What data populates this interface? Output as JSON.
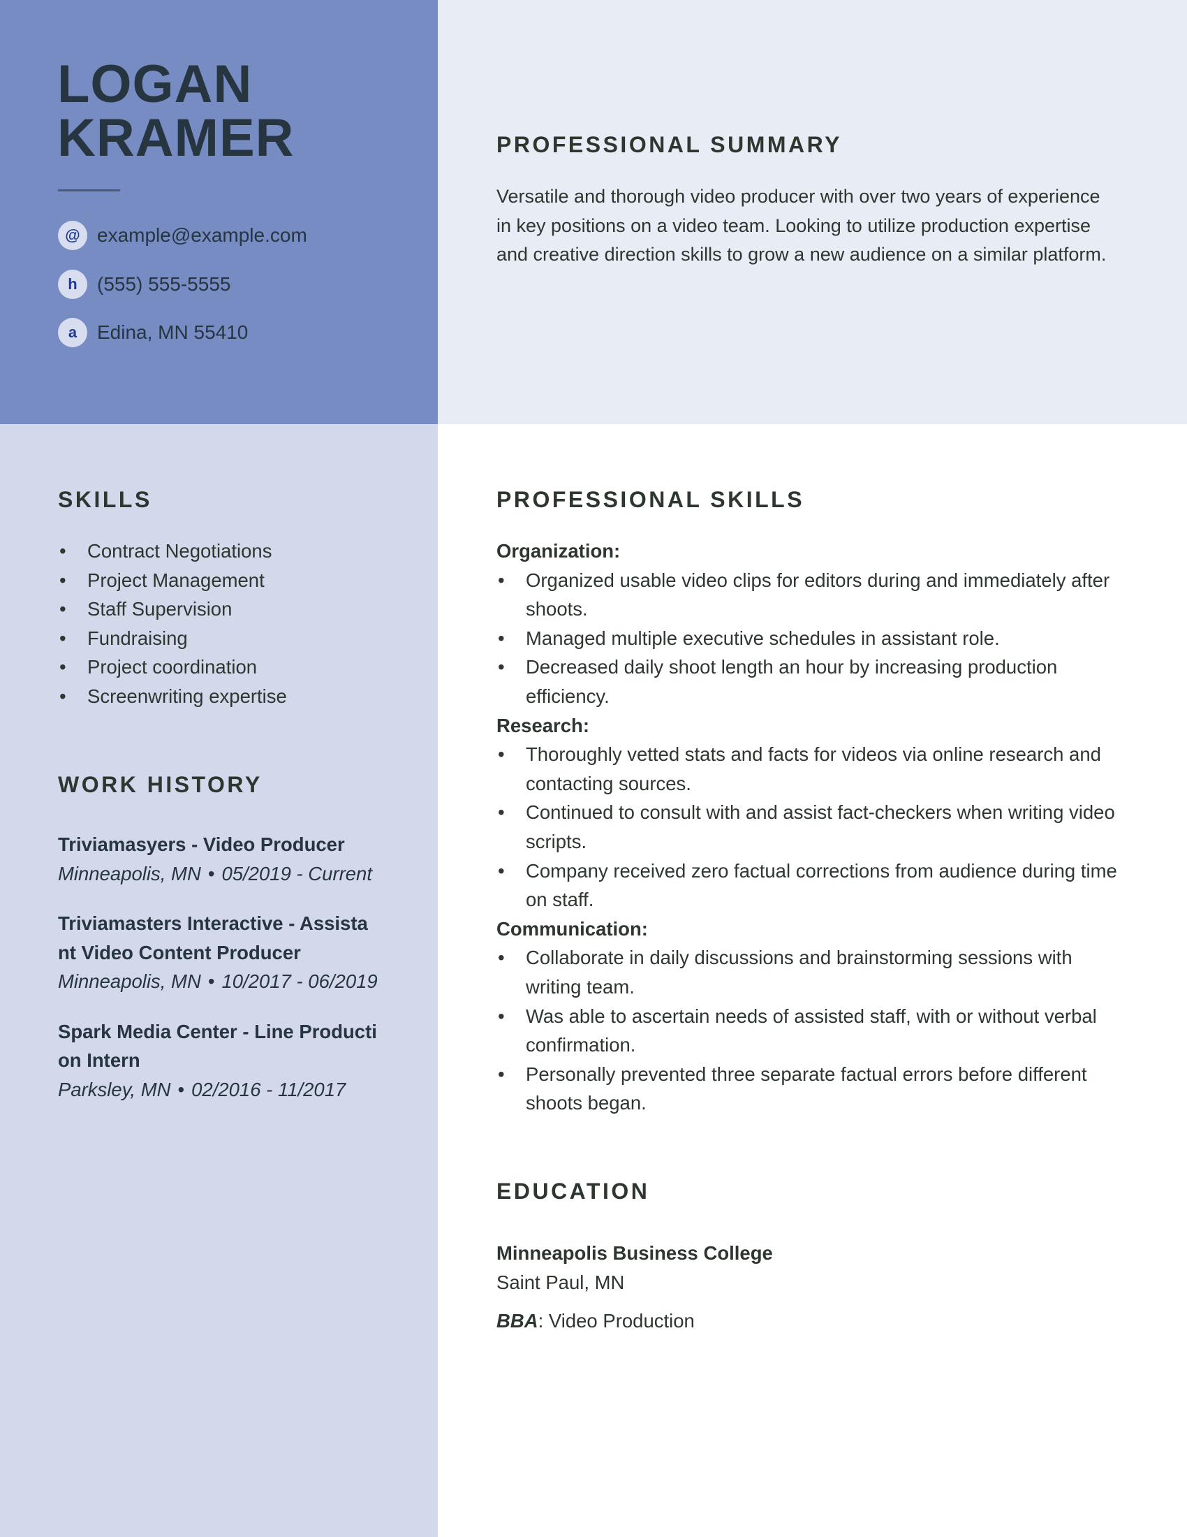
{
  "colors": {
    "header_left_bg": "#788cc4",
    "header_right_bg": "#e8ecf5",
    "sidebar_bg": "#d3d9eb",
    "main_bg": "#ffffff",
    "icon_glyph": "#1f3a93",
    "text_dark": "#2e3630"
  },
  "header": {
    "first_name": "LOGAN",
    "last_name": "KRAMER",
    "contacts": [
      {
        "icon": "email-icon",
        "glyph": "@",
        "text": "example@example.com"
      },
      {
        "icon": "phone-icon",
        "glyph": "h",
        "text": "(555) 555-5555"
      },
      {
        "icon": "address-icon",
        "glyph": "a",
        "text": "Edina, MN 55410"
      }
    ]
  },
  "summary": {
    "title": "PROFESSIONAL SUMMARY",
    "text": "Versatile and thorough video producer with over two years of experience in key positions on a video team. Looking to utilize production expertise and creative direction skills to grow a new audience on a similar platform."
  },
  "skills": {
    "title": "SKILLS",
    "items": [
      "Contract Negotiations",
      "Project Management",
      "Staff Supervision",
      "Fundraising",
      "Project coordination",
      "Screenwriting expertise"
    ]
  },
  "work_history": {
    "title": "WORK HISTORY",
    "jobs": [
      {
        "title": "Triviamasyers - Video Producer",
        "location": "Minneapolis, MN",
        "dates": "05/2019 - Current"
      },
      {
        "title": "Triviamasters Interactive - Assistant Video Content Producer",
        "location": "Minneapolis, MN",
        "dates": "10/2017 - 06/2019"
      },
      {
        "title": "Spark Media Center - Line Production Intern",
        "location": "Parksley, MN",
        "dates": "02/2016 - 11/2017"
      }
    ],
    "separator": "•"
  },
  "professional_skills": {
    "title": "PROFESSIONAL SKILLS",
    "groups": [
      {
        "label": "Organization:",
        "items": [
          "Organized usable video clips for editors during and immediately after shoots.",
          "Managed multiple executive schedules in assistant role.",
          "Decreased daily shoot length an hour by increasing production efficiency."
        ]
      },
      {
        "label": "Research:",
        "items": [
          "Thoroughly vetted stats and facts for videos via online research and contacting sources.",
          "Continued to consult with and assist fact-checkers when writing video scripts.",
          "Company received zero factual corrections from audience during time on staff."
        ]
      },
      {
        "label": "Communication:",
        "items": [
          "Collaborate in daily discussions and brainstorming sessions with writing team.",
          "Was able to ascertain needs of assisted staff, with or without verbal confirmation.",
          "Personally prevented three separate factual errors before different shoots began."
        ]
      }
    ]
  },
  "education": {
    "title": "EDUCATION",
    "school": "Minneapolis Business College",
    "location": "Saint Paul, MN",
    "degree": "BBA",
    "degree_separator": ":",
    "field": " Video Production"
  }
}
